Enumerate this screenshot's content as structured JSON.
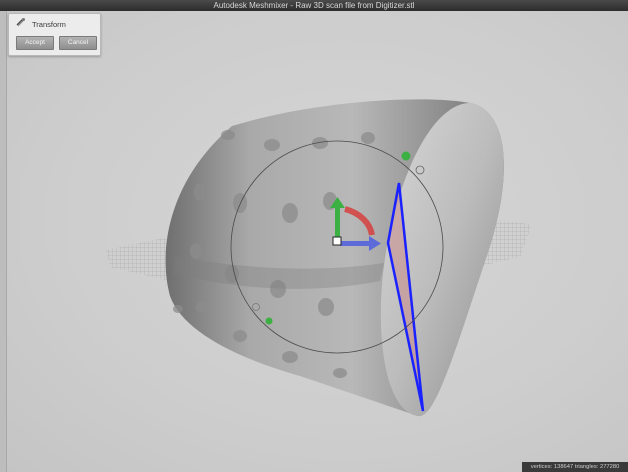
{
  "window": {
    "title": "Autodesk Meshmixer - Raw 3D scan file from Digitizer.stl"
  },
  "tool_panel": {
    "title": "Transform",
    "icon": "transform-icon",
    "accept_label": "Accept",
    "cancel_label": "Cancel"
  },
  "status_bar": {
    "text": "vertices: 138647 triangles: 277280"
  },
  "colors": {
    "viewport_bg": "#cfcfcf",
    "mesh": "#9a9a9a",
    "selection_outline": "#1a22ff",
    "selection_fill": "#c98a8a",
    "gizmo_green": "#3cb043",
    "gizmo_red": "#d64040",
    "gizmo_blue": "#5d6bd8"
  }
}
